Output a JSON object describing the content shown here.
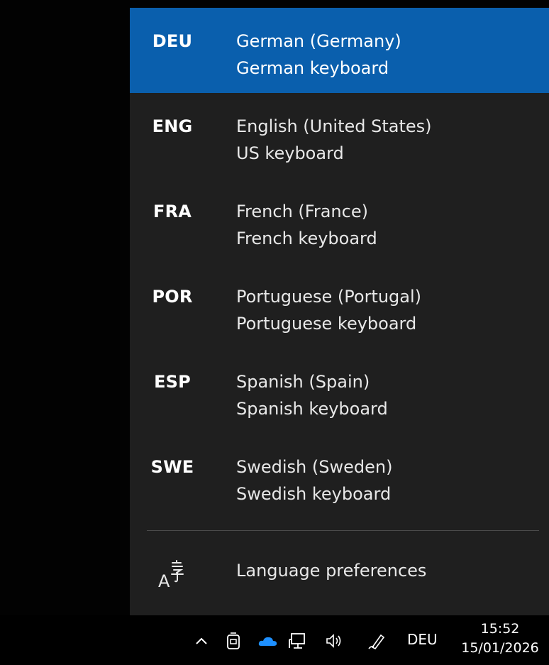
{
  "languages": [
    {
      "code": "DEU",
      "name": "German (Germany)",
      "keyboard": "German keyboard",
      "selected": true
    },
    {
      "code": "ENG",
      "name": "English (United States)",
      "keyboard": "US keyboard",
      "selected": false
    },
    {
      "code": "FRA",
      "name": "French (France)",
      "keyboard": "French keyboard",
      "selected": false
    },
    {
      "code": "POR",
      "name": "Portuguese (Portugal)",
      "keyboard": "Portuguese keyboard",
      "selected": false
    },
    {
      "code": "ESP",
      "name": "Spanish (Spain)",
      "keyboard": "Spanish keyboard",
      "selected": false
    },
    {
      "code": "SWE",
      "name": "Swedish (Sweden)",
      "keyboard": "Swedish keyboard",
      "selected": false
    }
  ],
  "preferences": {
    "label": "Language preferences",
    "icon": "language-icon"
  },
  "taskbar": {
    "icons": [
      "chevron-up-icon",
      "meet-now-icon",
      "onedrive-cloud-icon",
      "network-icon",
      "volume-icon",
      "pen-icon"
    ],
    "language": "DEU",
    "time": "15:52",
    "date": "15/01/2026"
  },
  "colors": {
    "selected": "#0a5fad",
    "flyout_bg": "#1f1f1f",
    "onedrive": "#1e90ff"
  }
}
